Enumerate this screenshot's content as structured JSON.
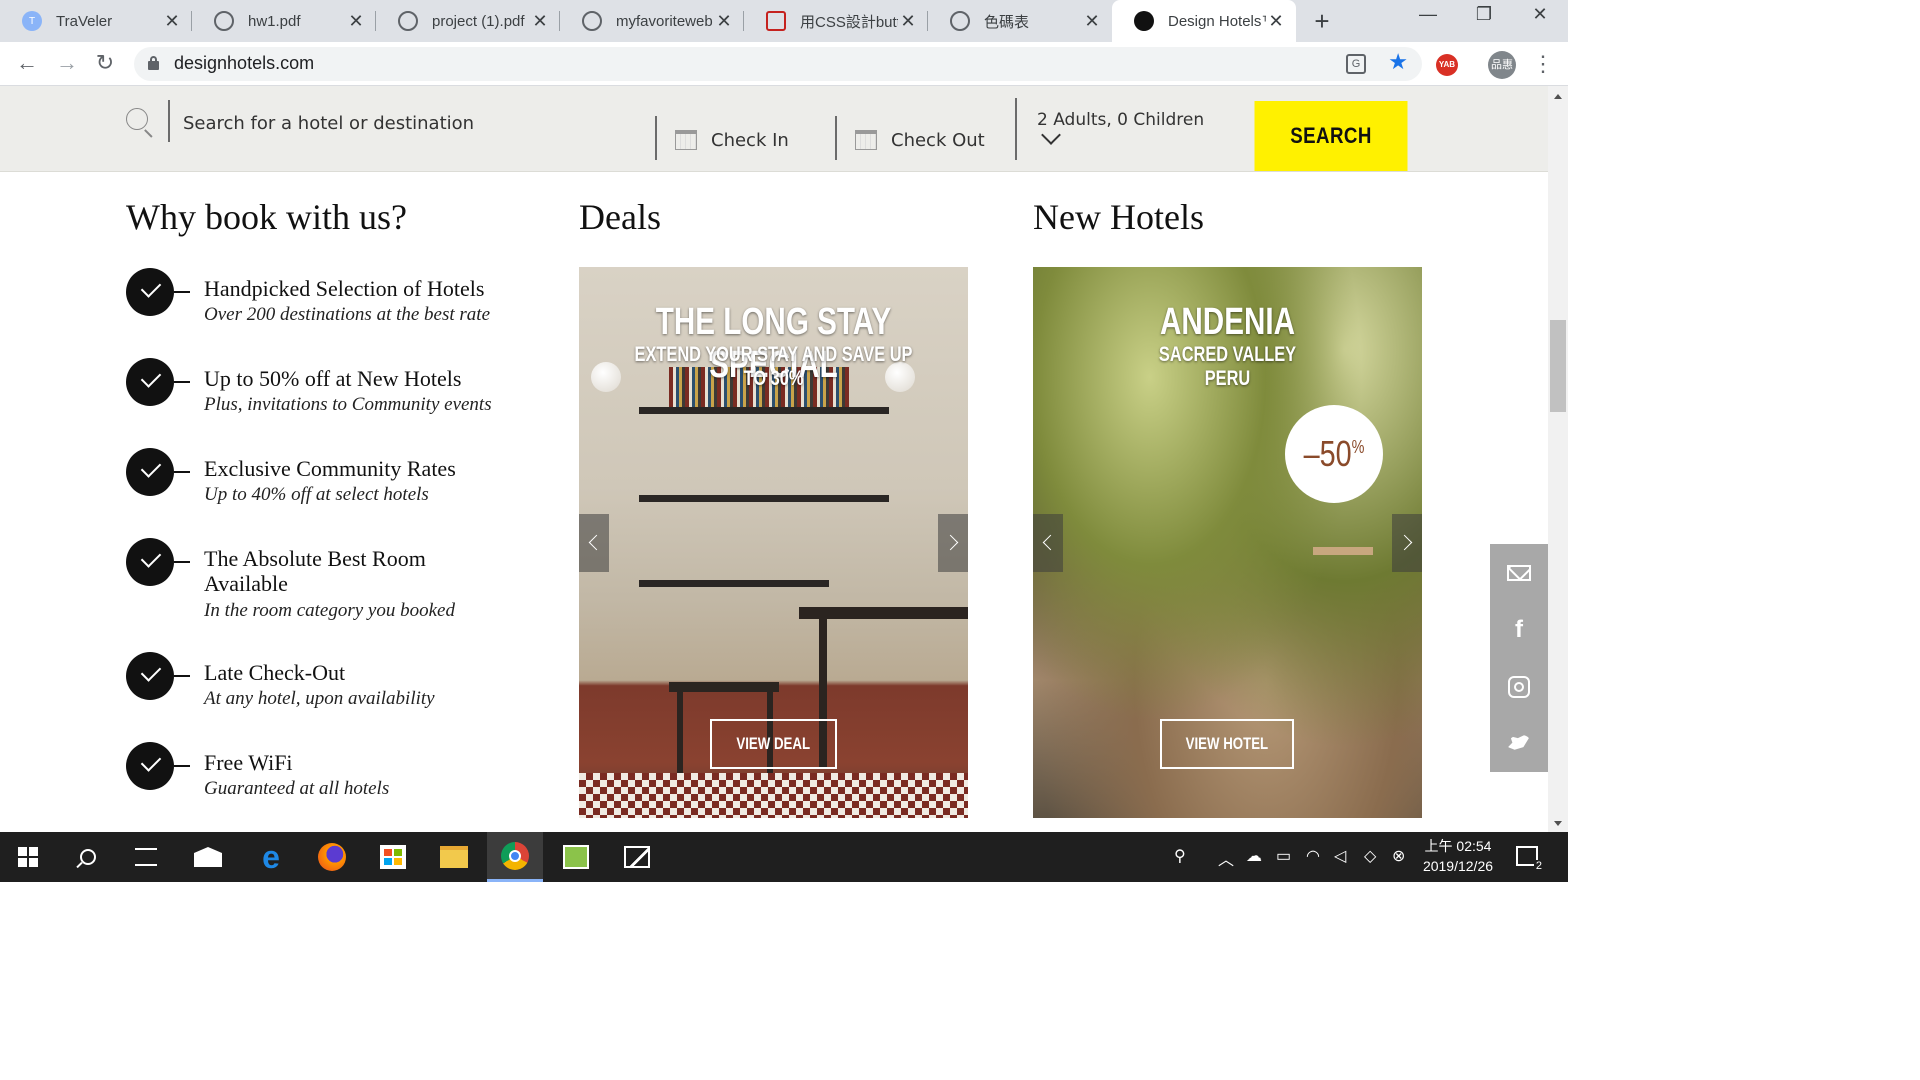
{
  "browser": {
    "tabs": [
      {
        "title": "TraVeler",
        "favicon_letter": "T",
        "favicon_color": "#8ab4f8"
      },
      {
        "title": "hw1.pdf",
        "favicon_color": "#5f6368"
      },
      {
        "title": "project (1).pdf",
        "favicon_color": "#5f6368"
      },
      {
        "title": "myfavoriteweb",
        "favicon_color": "#5f6368"
      },
      {
        "title": "用CSS設計butto",
        "favicon_color": "#c5221f"
      },
      {
        "title": "色碼表",
        "favicon_color": "#5f6368"
      },
      {
        "title": "Design Hotels™",
        "favicon_color": "#111111"
      }
    ],
    "new_tab_icon": "plus-icon",
    "url": "designhotels.com",
    "extension_label": "YAB",
    "profile_initials": "品惠"
  },
  "search_bar": {
    "placeholder": "Search for a hotel or destination",
    "check_in": "Check In",
    "check_out": "Check Out",
    "guests": "2 Adults, 0 Children",
    "search_button": "SEARCH",
    "accent_color": "#fff100"
  },
  "why_book": {
    "title": "Why book with us?",
    "items": [
      {
        "title": "Handpicked Selection of Hotels",
        "subtitle": "Over 200 destinations at the best rate"
      },
      {
        "title": "Up to 50% off at New Hotels",
        "subtitle": "Plus, invitations to Community events"
      },
      {
        "title": "Exclusive Community Rates",
        "subtitle": "Up to 40% off at select hotels"
      },
      {
        "title": "The Absolute Best Room Available",
        "subtitle": "In the room category you booked"
      },
      {
        "title": "Late Check-Out",
        "subtitle": "At any hotel, upon availability"
      },
      {
        "title": "Free WiFi",
        "subtitle": "Guaranteed at all hotels"
      }
    ]
  },
  "deals": {
    "title": "Deals",
    "headline": "THE LONG STAY SPECIAL",
    "subheadline": "EXTEND YOUR STAY AND SAVE UP TO 30%",
    "cta": "VIEW DEAL"
  },
  "new_hotels": {
    "title": "New Hotels",
    "hotel_name": "ANDENIA",
    "location_line1": "SACRED VALLEY",
    "location_line2": "PERU",
    "discount": "–50",
    "discount_unit": "%",
    "cta": "VIEW HOTEL"
  },
  "social": [
    "mail-icon",
    "facebook-icon",
    "instagram-icon",
    "twitter-icon"
  ],
  "taskbar": {
    "clock_time": "上午 02:54",
    "clock_date": "2019/12/26",
    "notification_count": "2"
  }
}
